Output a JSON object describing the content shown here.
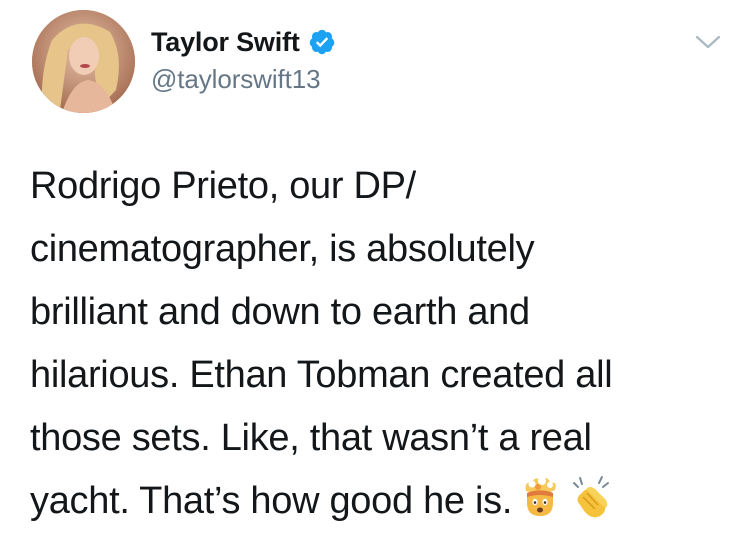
{
  "user": {
    "display_name": "Taylor Swift",
    "handle": "@taylorswift13",
    "verified": true,
    "avatar_icon": "profile-photo"
  },
  "menu": {
    "icon": "chevron-down-icon"
  },
  "tweet": {
    "lines": [
      "Rodrigo Prieto, our DP/",
      "cinematographer, is absolutely",
      "brilliant and down to earth and",
      "hilarious. Ethan Tobman created all",
      "those sets. Like, that wasn’t a real",
      "yacht. That’s how good he is."
    ],
    "emojis": [
      "exploding-head-emoji",
      "clapping-hands-emoji"
    ]
  },
  "colors": {
    "text": "#14171a",
    "secondary": "#657786",
    "verified_blue": "#1da1f2",
    "chevron": "#aab8c2"
  }
}
